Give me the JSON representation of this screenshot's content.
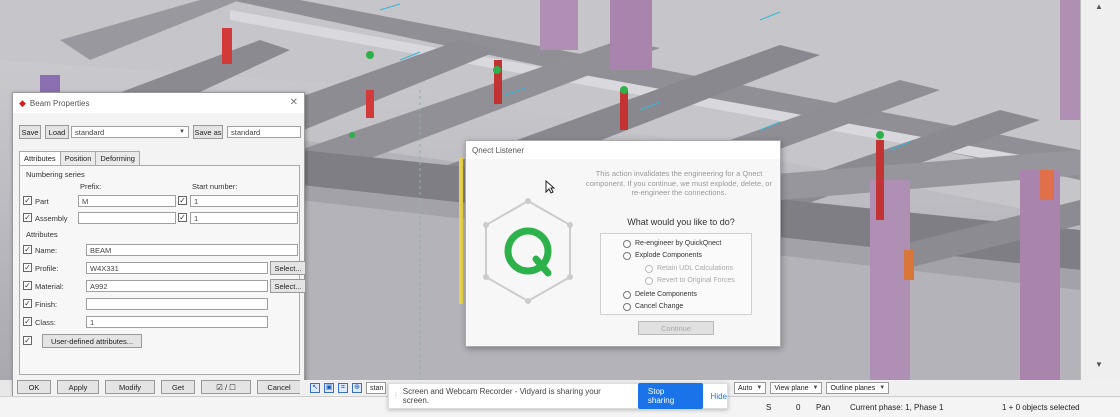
{
  "colors": {
    "accent": "#1a73e8",
    "qnect_green": "#2db14a",
    "steel_purple": "#b08fb4",
    "steel_gray": "#8d8d92"
  },
  "beam_dialog": {
    "title": "Beam Properties",
    "save": "Save",
    "load": "Load",
    "preset": "standard",
    "save_as": "Save as",
    "save_as_value": "standard",
    "tabs": [
      "Attributes",
      "Position",
      "Deforming"
    ],
    "numbering_series": "Numbering series",
    "prefix_label": "Prefix:",
    "start_number_label": "Start number:",
    "part_label": "Part",
    "part_prefix": "M",
    "part_start": "1",
    "assembly_label": "Assembly",
    "assembly_prefix": "",
    "assembly_start": "1",
    "attributes_header": "Attributes",
    "name_label": "Name:",
    "name_value": "BEAM",
    "profile_label": "Profile:",
    "profile_value": "W4X331",
    "material_label": "Material:",
    "material_value": "A992",
    "finish_label": "Finish:",
    "finish_value": "",
    "class_label": "Class:",
    "class_value": "1",
    "select1": "Select...",
    "select2": "Select...",
    "user_defined": "User-defined attributes...",
    "ok": "OK",
    "apply": "Apply",
    "modify": "Modify",
    "get": "Get",
    "toggle": "☑ / ☐",
    "cancel": "Cancel"
  },
  "qnect_dialog": {
    "title": "Qnect Listener",
    "message": "This action invalidates the engineering for a Qnect component. If you continue, we must explode, delete, or re-engineer the connections.",
    "question": "What would you like to do?",
    "options": [
      "Re-engineer by QuickQnect",
      "Explode Components",
      "Retain UDL Calculations",
      "Revert to Original Forces",
      "Delete Components",
      "Cancel Change"
    ],
    "continue": "Continue"
  },
  "toolbar": {
    "combo0": "stan",
    "auto": "Auto",
    "view_plane": "View plane",
    "outline_planes": "Outline planes"
  },
  "sharebar": {
    "text": "Screen and Webcam Recorder - Vidyard is sharing your screen.",
    "stop": "Stop sharing",
    "hide": "Hide"
  },
  "status": {
    "s": "S",
    "zero": "0",
    "pan": "Pan",
    "phase": "Current phase: 1, Phase 1",
    "selected": "1 + 0 objects selected"
  }
}
